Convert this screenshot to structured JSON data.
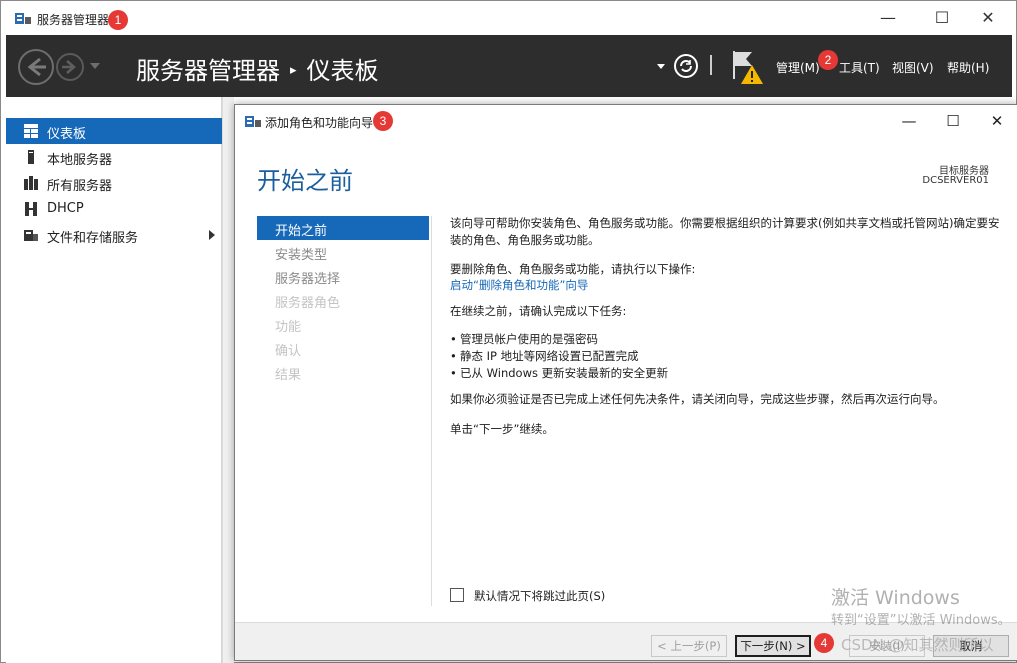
{
  "window": {
    "title": "服务器管理器"
  },
  "badges": [
    "1",
    "2",
    "3",
    "4"
  ],
  "header": {
    "breadcrumb_root": "服务器管理器",
    "breadcrumb_sep": "▸",
    "breadcrumb_page": "仪表板",
    "menu": [
      "管理(M)",
      "工具(T)",
      "视图(V)",
      "帮助(H)"
    ]
  },
  "sidebar": {
    "items": [
      {
        "label": "仪表板",
        "icon": "dashboard-icon",
        "active": true
      },
      {
        "label": "本地服务器",
        "icon": "server-icon"
      },
      {
        "label": "所有服务器",
        "icon": "servers-icon"
      },
      {
        "label": "DHCP",
        "icon": "dhcp-icon"
      },
      {
        "label": "文件和存储服务",
        "icon": "folder-icon",
        "has_children": true
      }
    ]
  },
  "dialog": {
    "title": "添加角色和功能向导",
    "heading": "开始之前",
    "target_label": "目标服务器",
    "target_value": "DCSERVER01",
    "steps": [
      {
        "label": "开始之前",
        "state": "active"
      },
      {
        "label": "安装类型",
        "state": "done"
      },
      {
        "label": "服务器选择",
        "state": "done"
      },
      {
        "label": "服务器角色",
        "state": "dim"
      },
      {
        "label": "功能",
        "state": "dim"
      },
      {
        "label": "确认",
        "state": "dim"
      },
      {
        "label": "结果",
        "state": "dim"
      }
    ],
    "intro": "该向导可帮助你安装角色、角色服务或功能。你需要根据组织的计算要求(例如共享文档或托管网站)确定要安装的角色、角色服务或功能。",
    "remove_text": "要删除角色、角色服务或功能，请执行以下操作:",
    "remove_link": "启动“删除角色和功能”向导",
    "before_text": "在继续之前，请确认完成以下任务:",
    "tasks": [
      "管理员帐户使用的是强密码",
      "静态 IP 地址等网络设置已配置完成",
      "已从 Windows 更新安装最新的安全更新"
    ],
    "verify_text": "如果你必须验证是否已完成上述任何先决条件，请关闭向导，完成这些步骤，然后再次运行向导。",
    "next_hint": "单击“下一步”继续。",
    "skip_label": "默认情况下将跳过此页(S)",
    "buttons": {
      "prev": "< 上一步(P)",
      "next": "下一步(N) >",
      "install": "安装(I)",
      "cancel": "取消"
    }
  },
  "watermark": {
    "line1": "激活 Windows",
    "line2": "转到“设置”以激活 Windows。",
    "line3": "CSDN @知其然则所以"
  }
}
